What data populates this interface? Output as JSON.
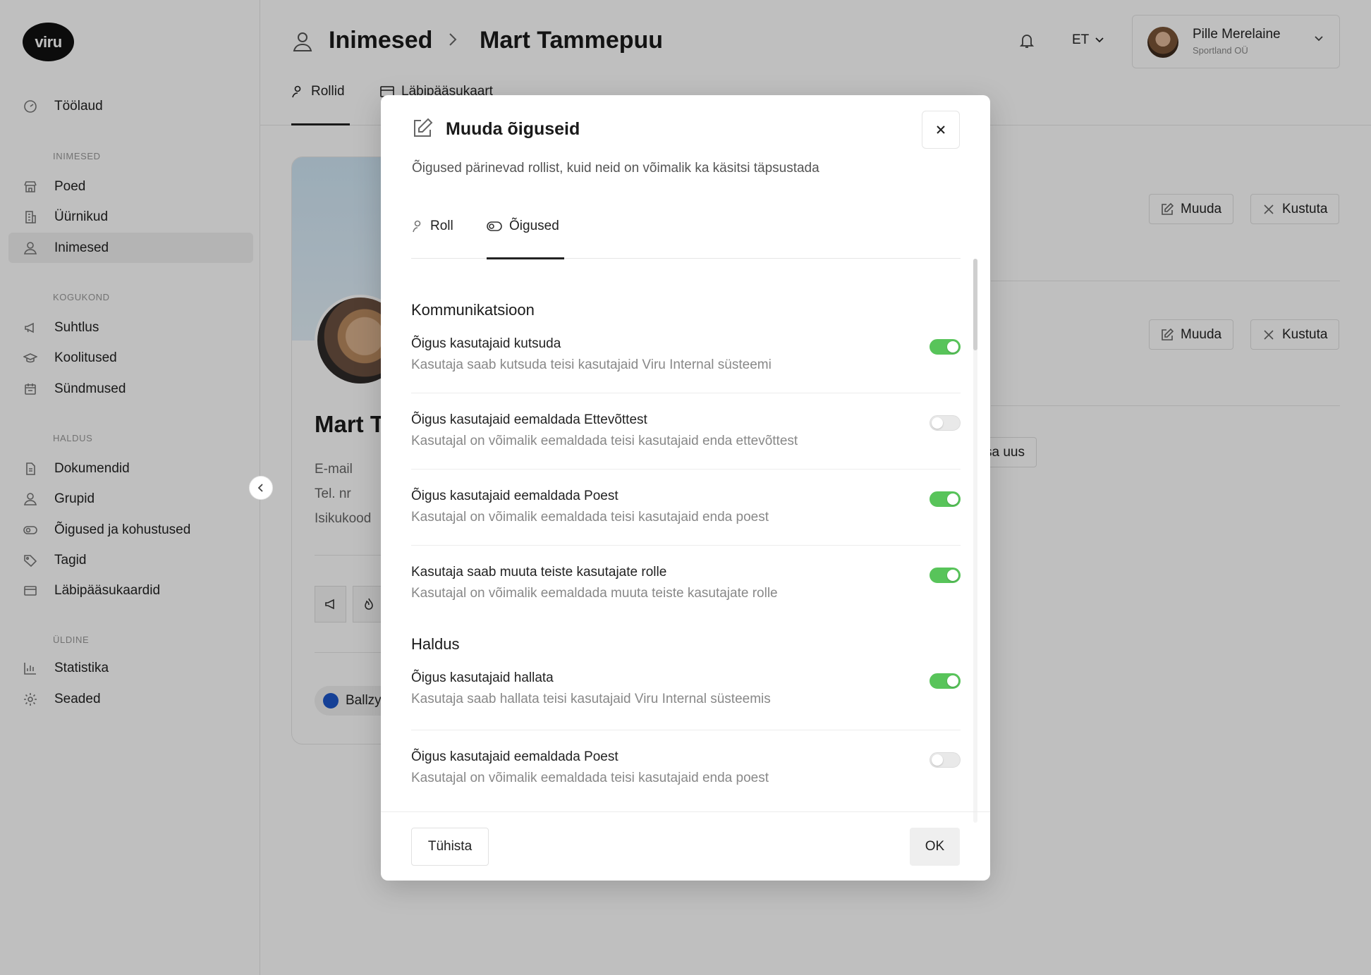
{
  "app": {
    "logo_text": "viru"
  },
  "sidebar": {
    "top_item": {
      "label": "Töölaud",
      "icon": "dashboard-icon"
    },
    "sections": [
      {
        "title": "INIMESED",
        "items": [
          {
            "label": "Poed",
            "icon": "store-icon"
          },
          {
            "label": "Üürnikud",
            "icon": "building-icon"
          },
          {
            "label": "Inimesed",
            "icon": "person-icon",
            "active": true
          }
        ]
      },
      {
        "title": "KOGUKOND",
        "items": [
          {
            "label": "Suhtlus",
            "icon": "megaphone-icon"
          },
          {
            "label": "Koolitused",
            "icon": "graduation-cap-icon"
          },
          {
            "label": "Sündmused",
            "icon": "calendar-icon"
          }
        ]
      },
      {
        "title": "HALDUS",
        "items": [
          {
            "label": "Dokumendid",
            "icon": "document-icon"
          },
          {
            "label": "Grupid",
            "icon": "group-icon"
          },
          {
            "label": "Õigused ja kohustused",
            "icon": "toggle-icon"
          },
          {
            "label": "Tagid",
            "icon": "tag-icon"
          },
          {
            "label": "Läbipääsukaardid",
            "icon": "card-icon"
          }
        ]
      },
      {
        "title": "ÜLDINE",
        "items": [
          {
            "label": "Statistika",
            "icon": "bar-chart-icon"
          },
          {
            "label": "Seaded",
            "icon": "gear-icon"
          }
        ]
      }
    ]
  },
  "header": {
    "breadcrumb": [
      "Inimesed",
      "Mart Tammepuu"
    ],
    "language": "ET",
    "user": {
      "name": "Pille Merelaine",
      "org": "Sportland OÜ"
    }
  },
  "main_tabs": [
    {
      "label": "Rollid",
      "active": true
    },
    {
      "label": "Läbipääsukaart",
      "active": false
    }
  ],
  "profile": {
    "name": "Mart T",
    "fields": [
      "E-mail",
      "Tel. nr",
      "Isikukood"
    ],
    "chip": "Ballzy"
  },
  "right_list": {
    "edit_label": "Muuda",
    "delete_label": "Kustuta",
    "add_label": "sa uus"
  },
  "modal": {
    "title": "Muuda õiguseid",
    "description": "Õigused pärinevad rollist, kuid neid on võimalik ka käsitsi täpsustada",
    "tabs": [
      {
        "label": "Roll",
        "active": false
      },
      {
        "label": "Õigused",
        "active": true
      }
    ],
    "sections": [
      {
        "title": "Kommunikatsioon",
        "permissions": [
          {
            "title": "Õigus kasutajaid kutsuda",
            "subtitle": "Kasutaja saab kutsuda teisi kasutajaid Viru Internal süsteemi",
            "enabled": true
          },
          {
            "title": "Õigus kasutajaid eemaldada Ettevõttest",
            "subtitle": "Kasutajal on võimalik eemaldada teisi kasutajaid enda ettevõttest",
            "enabled": false
          },
          {
            "title": "Õigus kasutajaid eemaldada Poest",
            "subtitle": "Kasutajal on võimalik eemaldada teisi kasutajaid enda poest",
            "enabled": true
          },
          {
            "title": "Kasutaja saab muuta teiste kasutajate rolle",
            "subtitle": "Kasutajal on võimalik eemaldada muuta teiste kasutajate rolle",
            "enabled": true
          }
        ]
      },
      {
        "title": "Haldus",
        "permissions": [
          {
            "title": "Õigus kasutajaid hallata",
            "subtitle": "Kasutaja saab hallata teisi kasutajaid Viru Internal süsteemis",
            "enabled": true
          },
          {
            "title": "Õigus kasutajaid eemaldada Poest",
            "subtitle": "Kasutajal on võimalik eemaldada teisi kasutajaid enda poest",
            "enabled": false
          }
        ]
      }
    ],
    "cancel_label": "Tühista",
    "ok_label": "OK",
    "toggle_on_color": "#58c45a"
  }
}
